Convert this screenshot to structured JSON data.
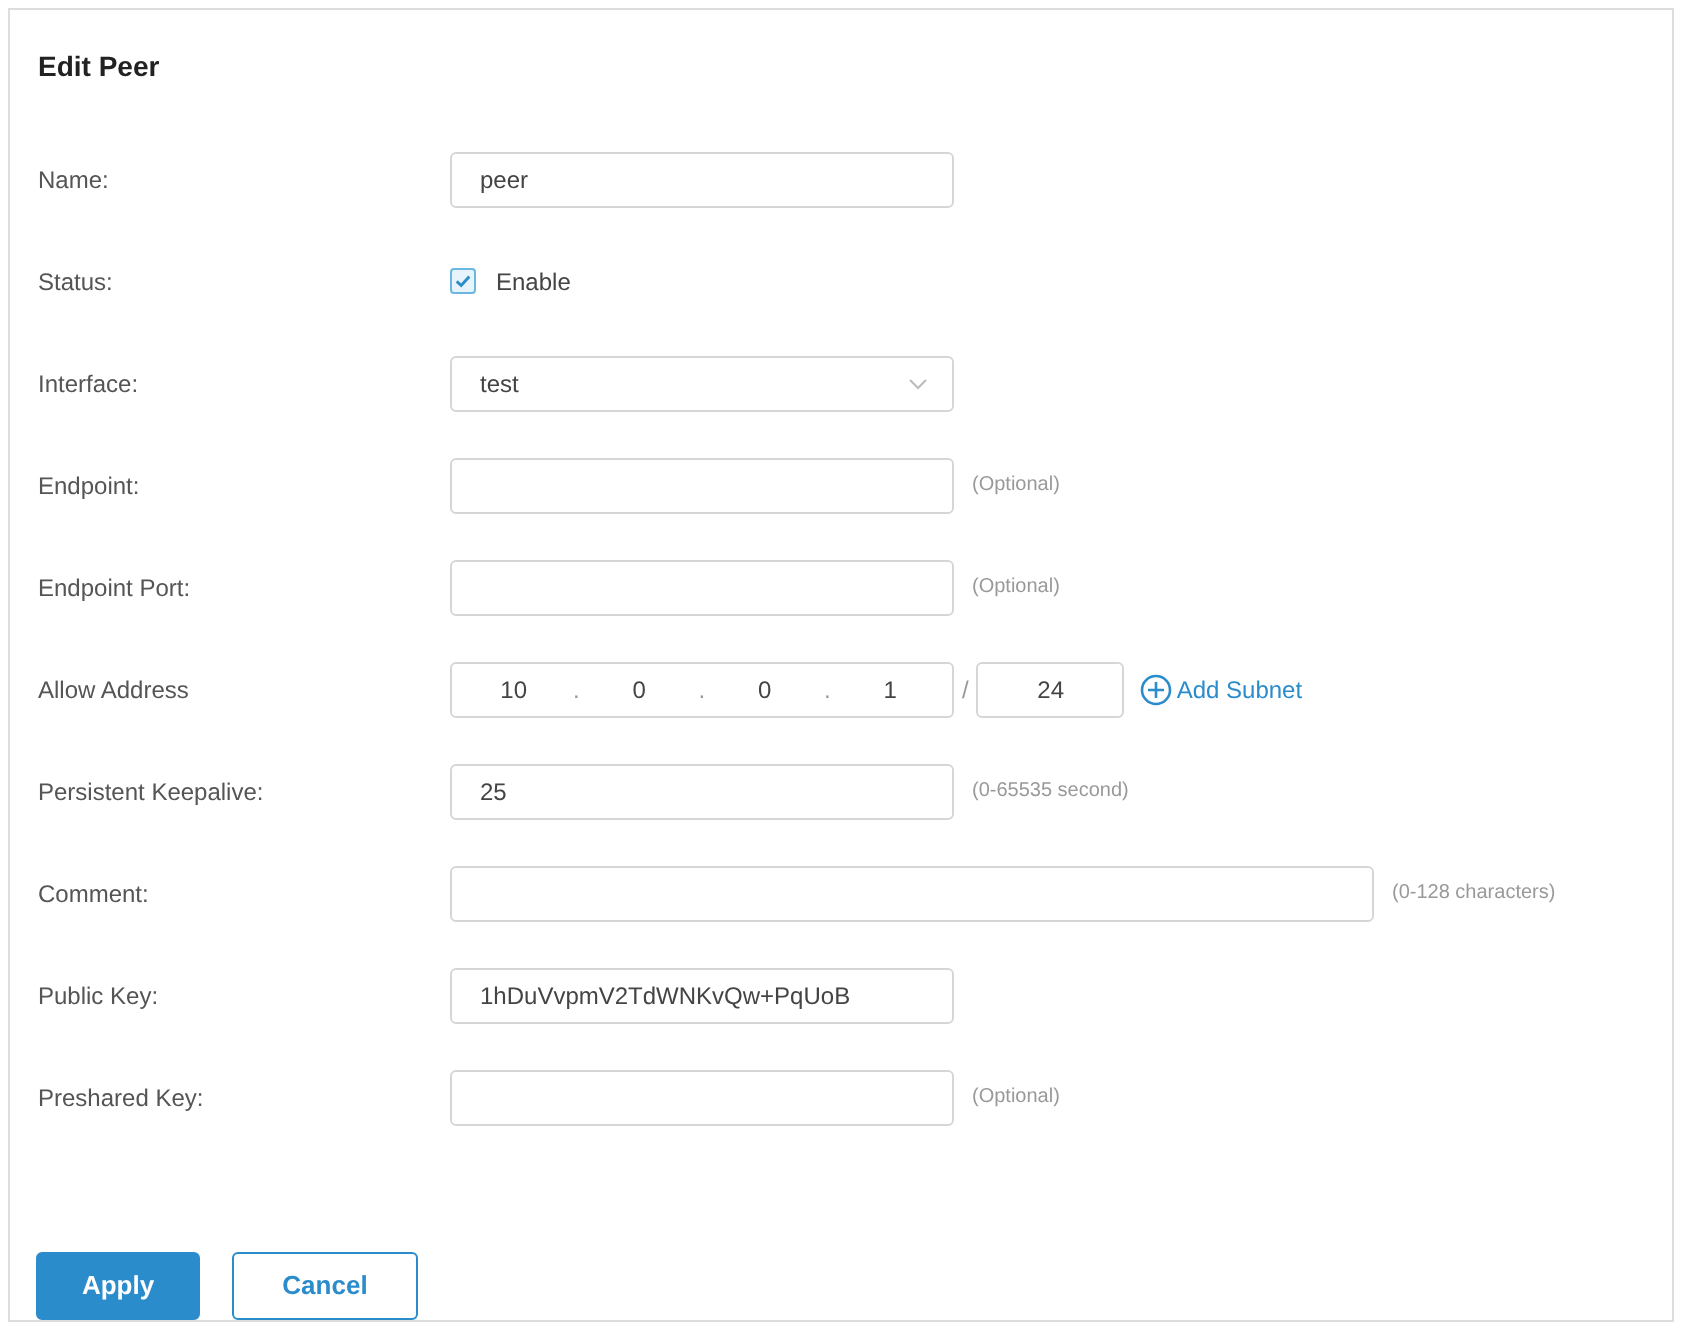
{
  "title": "Edit Peer",
  "rows": [
    {
      "kind": "text",
      "label": "Name:",
      "value": "peer"
    },
    {
      "kind": "checkbox",
      "label": "Status:",
      "option": "Enable",
      "checked": true
    },
    {
      "kind": "select",
      "label": "Interface:",
      "value": "test"
    },
    {
      "kind": "text",
      "label": "Endpoint:",
      "hint": "(Optional)"
    },
    {
      "kind": "text",
      "label": "Endpoint Port:",
      "hint": "(Optional)"
    },
    {
      "kind": "ip",
      "label": "Allow Address",
      "octets": [
        "10",
        "0",
        "0",
        "1"
      ],
      "octet_separator": ".",
      "separator": "/",
      "mask": "24",
      "link": "Add Subnet"
    },
    {
      "kind": "text",
      "label": "Persistent Keepalive:",
      "value": "25",
      "hint": "(0-65535 second)"
    },
    {
      "kind": "wide",
      "label": "Comment:",
      "hint": "(0-128 characters)"
    },
    {
      "kind": "text",
      "label": "Public Key:",
      "value": "1hDuVvpmV2TdWNKvQw+PqUoB"
    },
    {
      "kind": "text",
      "label": "Preshared Key:",
      "hint": "(Optional)"
    }
  ],
  "buttons": [
    {
      "kind": "primary",
      "label": "Apply"
    },
    {
      "kind": "secondary",
      "label": "Cancel"
    }
  ]
}
